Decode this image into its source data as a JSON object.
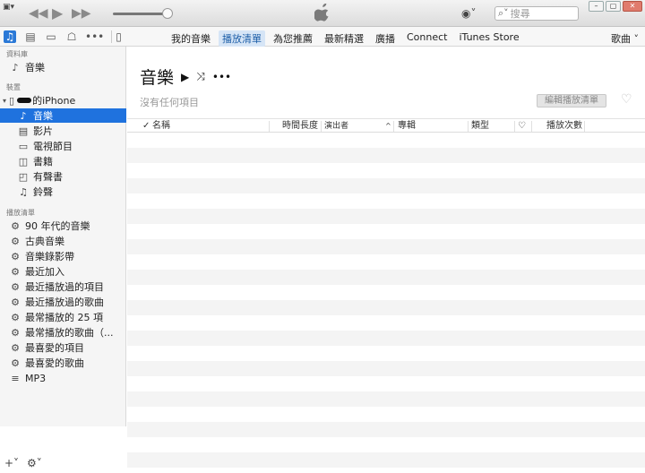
{
  "window": {
    "search_placeholder": "搜尋",
    "controls": [
      "minimize-button",
      "maximize-button",
      "close-button"
    ]
  },
  "nav": {
    "tabs": [
      {
        "label": "我的音樂",
        "selected": false
      },
      {
        "label": "播放清單",
        "selected": true
      },
      {
        "label": "為您推薦",
        "selected": false
      },
      {
        "label": "最新精選",
        "selected": false
      },
      {
        "label": "廣播",
        "selected": false
      },
      {
        "label": "Connect",
        "selected": false
      },
      {
        "label": "iTunes Store",
        "selected": false
      }
    ],
    "genre_label": "歌曲"
  },
  "sidebar": {
    "library_header": "資料庫",
    "library_items": [
      {
        "label": "音樂",
        "icon": "music-note-icon"
      }
    ],
    "devices_header": "裝置",
    "device_name": "的iPhone",
    "device_items": [
      {
        "label": "音樂",
        "icon": "music-note-icon",
        "selected": true
      },
      {
        "label": "影片",
        "icon": "film-icon",
        "selected": false
      },
      {
        "label": "電視節目",
        "icon": "tv-icon",
        "selected": false
      },
      {
        "label": "書籍",
        "icon": "book-icon",
        "selected": false
      },
      {
        "label": "有聲書",
        "icon": "audiobook-icon",
        "selected": false
      },
      {
        "label": "鈴聲",
        "icon": "bell-icon",
        "selected": false
      }
    ],
    "playlists_header": "播放清單",
    "playlists": [
      {
        "label": "90 年代的音樂",
        "icon": "gear-icon"
      },
      {
        "label": "古典音樂",
        "icon": "gear-icon"
      },
      {
        "label": "音樂錄影帶",
        "icon": "gear-icon"
      },
      {
        "label": "最近加入",
        "icon": "gear-icon"
      },
      {
        "label": "最近播放過的項目",
        "icon": "gear-icon"
      },
      {
        "label": "最近播放過的歌曲",
        "icon": "gear-icon"
      },
      {
        "label": "最常播放的 25 項",
        "icon": "gear-icon"
      },
      {
        "label": "最常播放的歌曲（...",
        "icon": "gear-icon"
      },
      {
        "label": "最喜愛的項目",
        "icon": "gear-icon"
      },
      {
        "label": "最喜愛的歌曲",
        "icon": "gear-icon"
      },
      {
        "label": "MP3",
        "icon": "playlist-icon"
      }
    ]
  },
  "main": {
    "title": "音樂",
    "empty_text": "沒有任何項目",
    "edit_button": "編輯播放清單",
    "columns": [
      "名稱",
      "時間長度",
      "演出者",
      "專輯",
      "類型",
      "播放次數"
    ]
  }
}
